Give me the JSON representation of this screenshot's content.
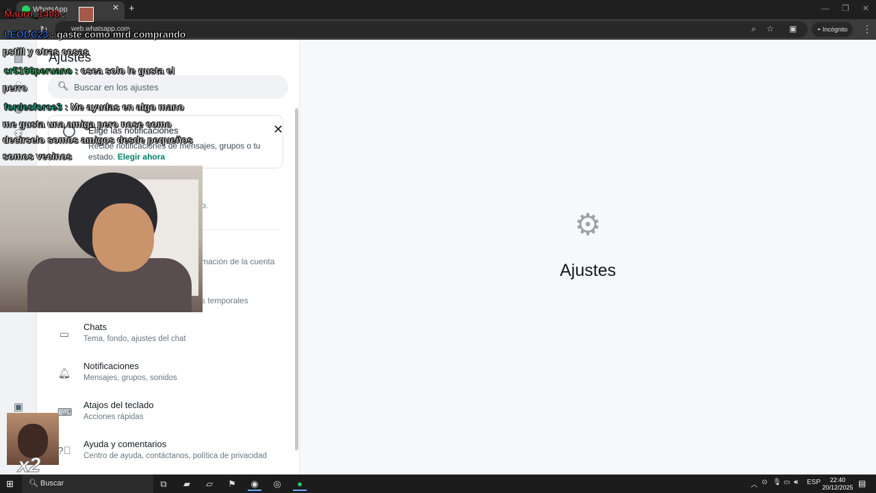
{
  "browser": {
    "tab_title": "WhatsApp",
    "address": "web.whatsapp.com",
    "incognito_label": "Incógnito"
  },
  "settings": {
    "title": "Ajustes",
    "search_placeholder": "Buscar en los ajustes",
    "notification_card": {
      "title": "Elige las notificaciones",
      "description": "Recibe notificaciones de mensajes, grupos o tu estado.",
      "link": "Elegir ahora"
    },
    "fragments": {
      "profile": "p.",
      "account": "rmación de la cuenta",
      "privacy": "s temporales"
    },
    "items": [
      {
        "title": "Chats",
        "subtitle": "Tema, fondo, ajustes del chat",
        "icon": "chat-icon"
      },
      {
        "title": "Notificaciones",
        "subtitle": "Mensajes, grupos, sonidos",
        "icon": "bell-icon"
      },
      {
        "title": "Atajos del teclado",
        "subtitle": "Acciones rápidas",
        "icon": "keyboard-icon"
      },
      {
        "title": "Ayuda y comentarios",
        "subtitle": "Centro de ayuda, contáctanos, política de privacidad",
        "icon": "help-icon"
      }
    ]
  },
  "main": {
    "title": "Ajustes",
    "icon": "gear-icon"
  },
  "overlay": {
    "chat": [
      {
        "user": "Mauro_1408",
        "text": ":",
        "user_color": "#ff3b3b"
      },
      {
        "user": "LEODC23",
        "text": ": gaste como mrd comprando",
        "user_color": "#3b7dff"
      },
      {
        "user": "",
        "text": "pstill y otras cosas",
        "user_color": "#ffffff"
      },
      {
        "user": "cr5166peruano",
        "text": ": osea solo le gusta el",
        "user_color": "#45d17a"
      },
      {
        "user": "",
        "text": "perro",
        "user_color": "#ffffff"
      },
      {
        "user": "fordesforce3",
        "text": ": Me ayudas en algo mano",
        "user_color": "#2fd3a0"
      },
      {
        "user": "",
        "text": "me gusta una amiga pero nose como",
        "user_color": "#ffffff"
      },
      {
        "user": "",
        "text": "decirselo somos amigos desde pequeños",
        "user_color": "#ffffff"
      },
      {
        "user": "",
        "text": "somos vecinos",
        "user_color": "#ffffff"
      }
    ],
    "multiplier": "x2"
  },
  "taskbar": {
    "search_label": "Buscar",
    "language": "ESP",
    "time": "22:40",
    "date": "20/12/2025"
  }
}
